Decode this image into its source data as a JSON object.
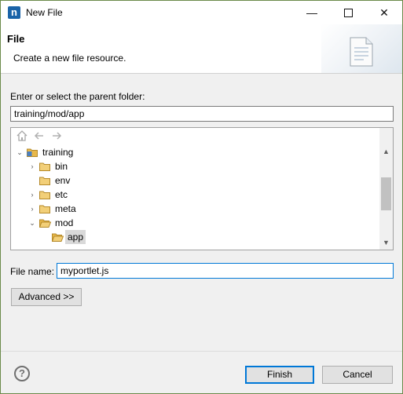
{
  "window": {
    "title": "New File",
    "app_icon_glyph": "n",
    "minimize_glyph": "—",
    "close_glyph": "✕"
  },
  "banner": {
    "title": "File",
    "description": "Create a new file resource."
  },
  "parent_folder": {
    "label": "Enter or select the parent folder:",
    "value": "training/mod/app"
  },
  "tree": {
    "toolbar_icons": [
      "home-icon",
      "back-arrow-icon",
      "forward-arrow-icon"
    ],
    "items": [
      {
        "label": "training",
        "expanded": true,
        "type": "project"
      },
      {
        "label": "bin",
        "expanded": false,
        "type": "folder"
      },
      {
        "label": "env",
        "expanded": null,
        "type": "folder"
      },
      {
        "label": "etc",
        "expanded": false,
        "type": "folder"
      },
      {
        "label": "meta",
        "expanded": false,
        "type": "folder"
      },
      {
        "label": "mod",
        "expanded": true,
        "type": "folder"
      },
      {
        "label": "app",
        "expanded": null,
        "type": "folder",
        "selected": true
      }
    ]
  },
  "file_name": {
    "label": "File name:",
    "value": "myportlet.js"
  },
  "buttons": {
    "advanced": "Advanced >>",
    "finish": "Finish",
    "cancel": "Cancel",
    "help_glyph": "?"
  },
  "colors": {
    "accent": "#0078d7",
    "folder": "#e8b84a",
    "selection": "#d9d9d9"
  }
}
